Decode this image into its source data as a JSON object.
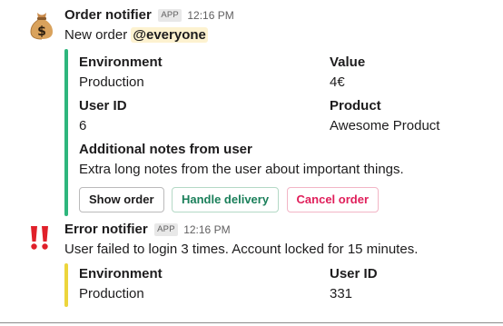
{
  "order_message": {
    "sender": "Order notifier",
    "badge": "APP",
    "time": "12:16 PM",
    "text_prefix": "New order",
    "mention": "@everyone",
    "accent_color": "#2eb67d",
    "fields": [
      {
        "label": "Environment",
        "value": "Production"
      },
      {
        "label": "Value",
        "value": "4€"
      },
      {
        "label": "User ID",
        "value": "6"
      },
      {
        "label": "Product",
        "value": "Awesome Product"
      }
    ],
    "notes": {
      "label": "Additional notes from user",
      "value": "Extra long notes from the user about important things."
    },
    "buttons": {
      "show": "Show order",
      "handle": "Handle delivery",
      "cancel": "Cancel order"
    }
  },
  "error_message": {
    "sender": "Error notifier",
    "badge": "APP",
    "time": "12:16 PM",
    "text": "User failed to login 3 times. Account locked for 15 minutes.",
    "accent_color": "#ecd53c",
    "fields": [
      {
        "label": "Environment",
        "value": "Production"
      },
      {
        "label": "User ID",
        "value": "331"
      }
    ]
  },
  "icons": {
    "order_avatar": "money-bag-icon",
    "error_avatar": "double-exclamation-icon"
  }
}
